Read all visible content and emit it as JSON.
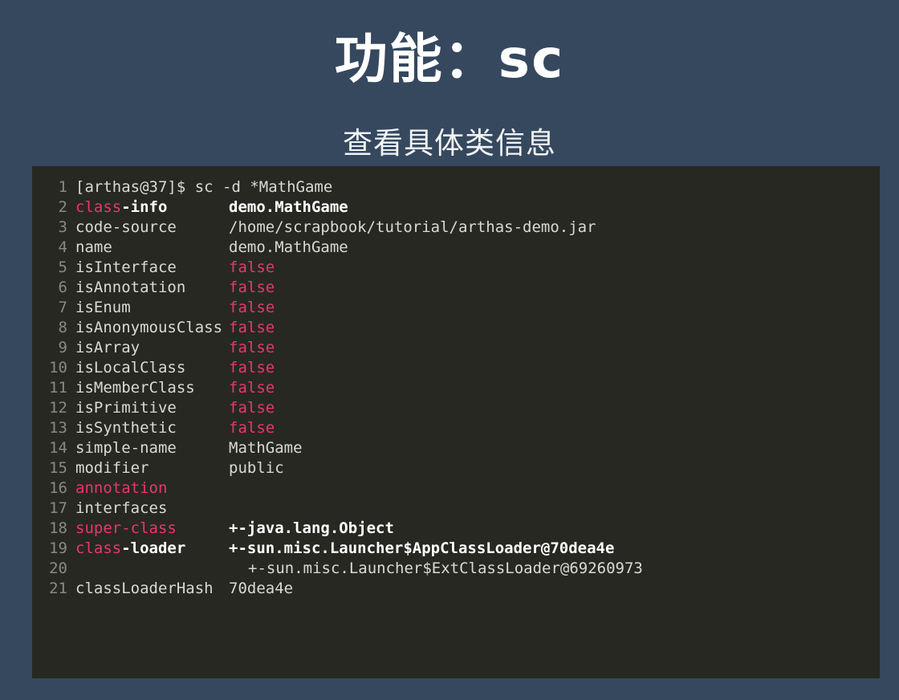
{
  "slide": {
    "title": "功能：sc",
    "subtitle": "查看具体类信息",
    "background_color": "#35485e",
    "terminal_background_color": "#272821",
    "accent_color": "#e8376b",
    "text_color": "#d9dad3",
    "line_number_color": "#8a8a82"
  },
  "terminal": {
    "command_line": "[arthas@37]$ sc -d *MathGame",
    "lines": [
      {
        "n": "1",
        "type": "command",
        "text": "[arthas@37]$ sc -d *MathGame"
      },
      {
        "n": "2",
        "type": "kv",
        "key_pink": "class",
        "key_rest": "-info",
        "key_rest_bold": true,
        "value": "demo.MathGame",
        "value_style": "bold-white"
      },
      {
        "n": "3",
        "type": "kv",
        "key_pink": "",
        "key_rest": "code-source",
        "key_rest_bold": false,
        "value": "/home/scrapbook/tutorial/arthas-demo.jar",
        "value_style": "white"
      },
      {
        "n": "4",
        "type": "kv",
        "key_pink": "",
        "key_rest": "name",
        "key_rest_bold": false,
        "value": "demo.MathGame",
        "value_style": "white"
      },
      {
        "n": "5",
        "type": "kv",
        "key_pink": "",
        "key_rest": "isInterface",
        "key_rest_bold": false,
        "value": "false",
        "value_style": "pink"
      },
      {
        "n": "6",
        "type": "kv",
        "key_pink": "",
        "key_rest": "isAnnotation",
        "key_rest_bold": false,
        "value": "false",
        "value_style": "pink"
      },
      {
        "n": "7",
        "type": "kv",
        "key_pink": "",
        "key_rest": "isEnum",
        "key_rest_bold": false,
        "value": "false",
        "value_style": "pink"
      },
      {
        "n": "8",
        "type": "kv",
        "key_pink": "",
        "key_rest": "isAnonymousClass",
        "key_rest_bold": false,
        "value": "false",
        "value_style": "pink"
      },
      {
        "n": "9",
        "type": "kv",
        "key_pink": "",
        "key_rest": "isArray",
        "key_rest_bold": false,
        "value": "false",
        "value_style": "pink"
      },
      {
        "n": "10",
        "type": "kv",
        "key_pink": "",
        "key_rest": "isLocalClass",
        "key_rest_bold": false,
        "value": "false",
        "value_style": "pink"
      },
      {
        "n": "11",
        "type": "kv",
        "key_pink": "",
        "key_rest": "isMemberClass",
        "key_rest_bold": false,
        "value": "false",
        "value_style": "pink"
      },
      {
        "n": "12",
        "type": "kv",
        "key_pink": "",
        "key_rest": "isPrimitive",
        "key_rest_bold": false,
        "value": "false",
        "value_style": "pink"
      },
      {
        "n": "13",
        "type": "kv",
        "key_pink": "",
        "key_rest": "isSynthetic",
        "key_rest_bold": false,
        "value": "false",
        "value_style": "pink"
      },
      {
        "n": "14",
        "type": "kv",
        "key_pink": "",
        "key_rest": "simple-name",
        "key_rest_bold": false,
        "value": "MathGame",
        "value_style": "white"
      },
      {
        "n": "15",
        "type": "kv",
        "key_pink": "",
        "key_rest": "modifier",
        "key_rest_bold": false,
        "value": "public",
        "value_style": "white"
      },
      {
        "n": "16",
        "type": "kv",
        "key_pink": "annotation",
        "key_rest": "",
        "key_rest_bold": false,
        "value": "",
        "value_style": "white"
      },
      {
        "n": "17",
        "type": "kv",
        "key_pink": "",
        "key_rest": "interfaces",
        "key_rest_bold": false,
        "value": "",
        "value_style": "white"
      },
      {
        "n": "18",
        "type": "kv",
        "key_pink": "super-class",
        "key_rest": "",
        "key_rest_bold": false,
        "value": "+-java.lang.Object",
        "value_style": "bold-white"
      },
      {
        "n": "19",
        "type": "kv",
        "key_pink": "class",
        "key_rest": "-loader",
        "key_rest_bold": true,
        "value": "+-sun.misc.Launcher$AppClassLoader@70dea4e",
        "value_style": "bold-white"
      },
      {
        "n": "20",
        "type": "tree",
        "key_pink": "",
        "key_rest": "",
        "key_rest_bold": false,
        "value": "+-sun.misc.Launcher$ExtClassLoader@69260973",
        "value_style": "white"
      },
      {
        "n": "21",
        "type": "kv",
        "key_pink": "",
        "key_rest": "classLoaderHash",
        "key_rest_bold": false,
        "value": "70dea4e",
        "value_style": "white"
      }
    ]
  }
}
